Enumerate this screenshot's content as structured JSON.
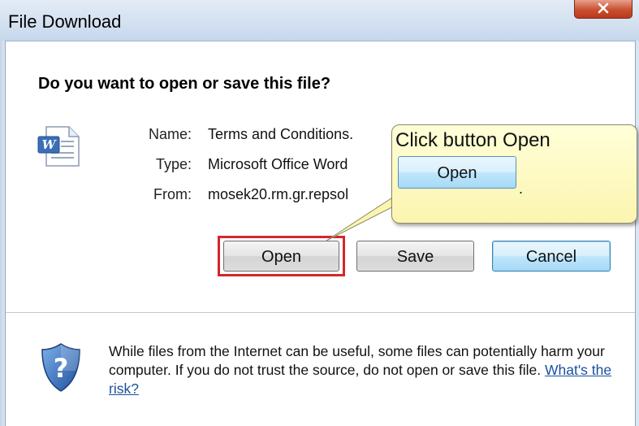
{
  "window": {
    "title": "File Download"
  },
  "dialog": {
    "question": "Do you want to open or save this file?",
    "fields": {
      "name_label": "Name:",
      "name_value": "Terms and Conditions.",
      "type_label": "Type:",
      "type_value": "Microsoft Office Word",
      "from_label": "From:",
      "from_value": "mosek20.rm.gr.repsol"
    },
    "buttons": {
      "open": "Open",
      "save": "Save",
      "cancel": "Cancel"
    },
    "warning": {
      "text": "While files from the Internet can be useful, some files can potentially harm your computer. If you do not trust the source, do not open or save this file.",
      "link": "What's the risk?"
    }
  },
  "callout": {
    "text": "Click button Open",
    "button_label": "Open",
    "dot": "."
  },
  "icons": {
    "document": "word-document-icon",
    "shield": "security-shield-question-icon",
    "close": "close-x-icon"
  },
  "colors": {
    "highlight": "#d4262c",
    "link": "#1a4f9e",
    "callout_bg": "#fcf7b8",
    "close_button": "#c8502f"
  }
}
